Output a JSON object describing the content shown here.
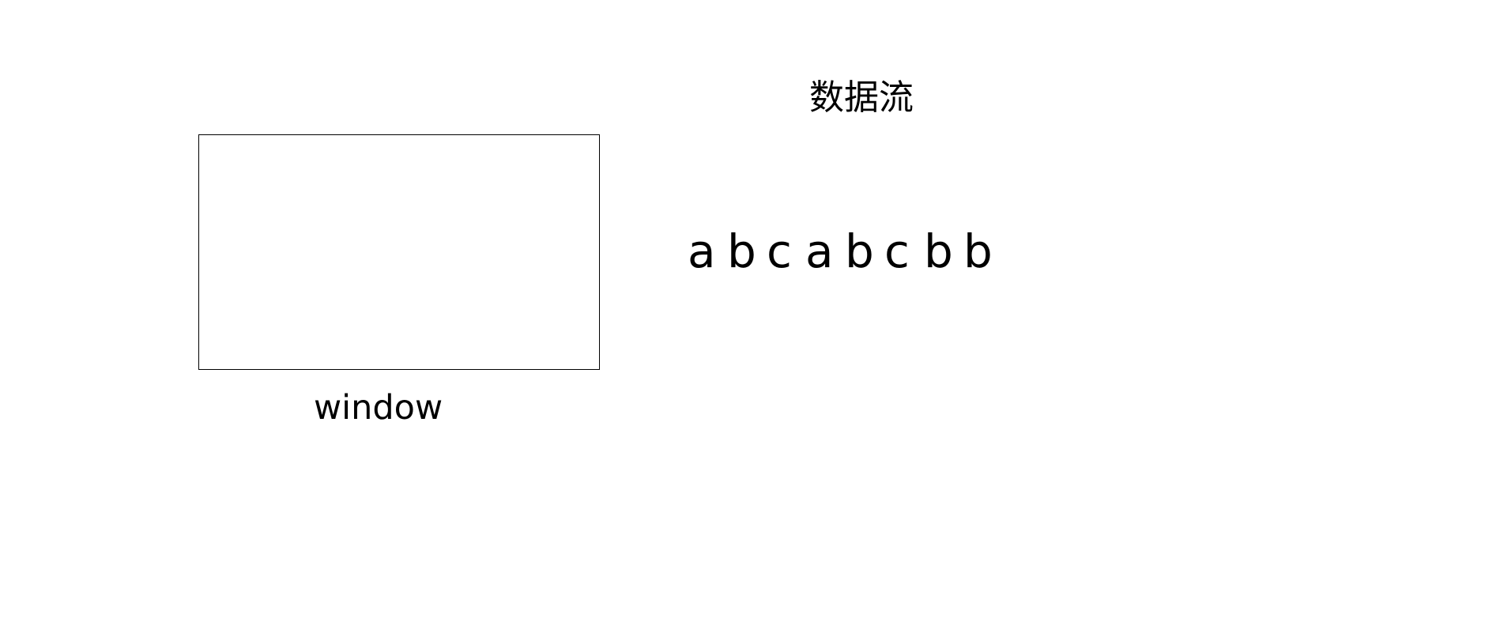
{
  "window": {
    "label": "window"
  },
  "stream": {
    "title": "数据流",
    "chars": [
      "a",
      "b",
      "c",
      "a",
      "b",
      "c",
      "b",
      "b"
    ]
  }
}
